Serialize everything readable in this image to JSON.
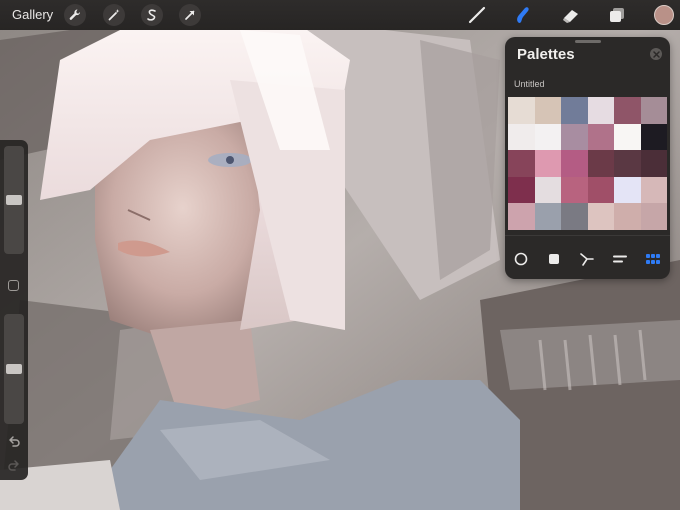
{
  "toolbar": {
    "gallery_label": "Gallery",
    "left_tools": [
      "wrench-icon",
      "magic-wand-icon",
      "selection-icon",
      "transform-arrow-icon"
    ],
    "right_tools": [
      "brush-icon",
      "smudge-icon",
      "eraser-icon",
      "layers-icon"
    ],
    "active_tool": "smudge-icon",
    "accent_color": "#2f7bf5",
    "current_color": "#b99188"
  },
  "palettes": {
    "title": "Palettes",
    "palette_name": "Untitled",
    "swatches": [
      "#e6dcd4",
      "#d6c4b6",
      "#717c99",
      "#e6dce2",
      "#8f5568",
      "#a58d97",
      "#f0ecec",
      "#f3f1f2",
      "#a88da1",
      "#b0728a",
      "#f8f6f4",
      "#1d1b22",
      "#87445a",
      "#de99b0",
      "#b45c84",
      "#6b3a48",
      "#5a3843",
      "#4b2e38",
      "#7e2f4d",
      "#e4dde0",
      "#b8637f",
      "#a04f68",
      "#e4e4f6",
      "#d6b8b8",
      "#cda3ad",
      "#9aa0ac",
      "#7a7a83",
      "#ddc4c0",
      "#cfaeab",
      "#c6a6a8"
    ],
    "modes": [
      "disc-icon",
      "classic-icon",
      "harmony-icon",
      "value-icon",
      "palettes-grid-icon"
    ],
    "active_mode": "palettes-grid-icon"
  },
  "sidebar": {
    "brush_size_level": 0.5,
    "opacity_level": 0.5
  }
}
